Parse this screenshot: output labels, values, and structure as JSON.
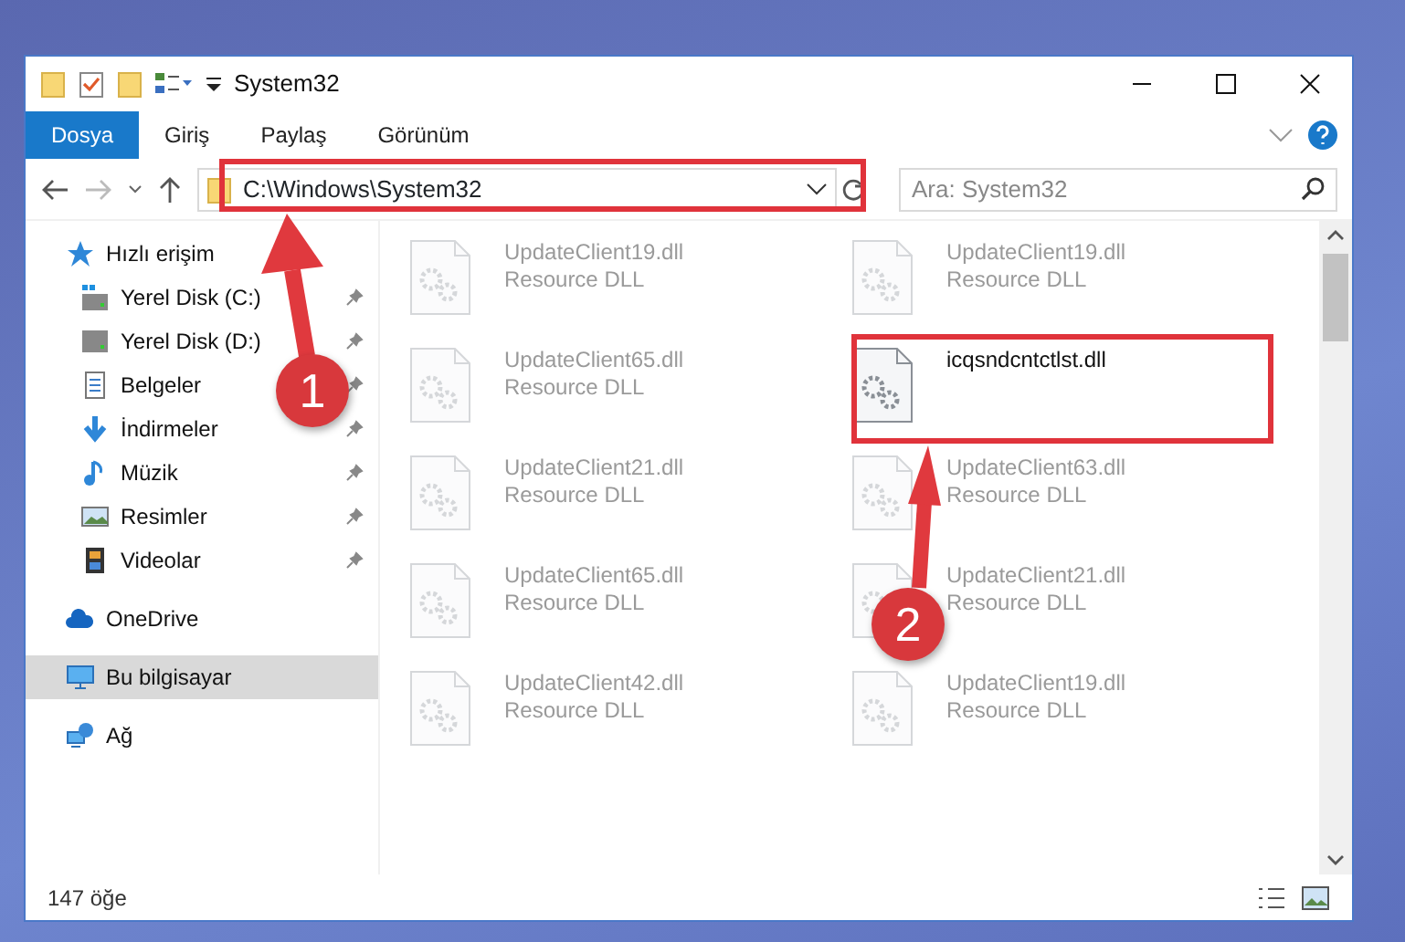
{
  "window": {
    "title": "System32"
  },
  "ribbon_tabs": [
    {
      "label": "Dosya",
      "selected": true
    },
    {
      "label": "Giriş",
      "selected": false
    },
    {
      "label": "Paylaş",
      "selected": false
    },
    {
      "label": "Görünüm",
      "selected": false
    }
  ],
  "address_bar": {
    "path": "C:\\Windows\\System32"
  },
  "search": {
    "placeholder": "Ara: System32"
  },
  "sidebar": {
    "items": [
      {
        "label": "Hızlı erişim",
        "kind": "star",
        "selected": false,
        "children": [
          {
            "label": "Yerel Disk (C:)",
            "kind": "drive-win",
            "pinned": true,
            "selected": false
          },
          {
            "label": "Yerel Disk (D:)",
            "kind": "drive",
            "pinned": true,
            "selected": false
          },
          {
            "label": "Belgeler",
            "kind": "docs",
            "pinned": true,
            "selected": false
          },
          {
            "label": "İndirmeler",
            "kind": "download",
            "pinned": true,
            "selected": false
          },
          {
            "label": "Müzik",
            "kind": "music",
            "pinned": true,
            "selected": false
          },
          {
            "label": "Resimler",
            "kind": "pictures",
            "pinned": true,
            "selected": false
          },
          {
            "label": "Videolar",
            "kind": "videos",
            "pinned": true,
            "selected": false
          }
        ]
      },
      {
        "label": "OneDrive",
        "kind": "cloud",
        "selected": false
      },
      {
        "label": "Bu bilgisayar",
        "kind": "pc",
        "selected": true
      },
      {
        "label": "Ağ",
        "kind": "network",
        "selected": false
      }
    ]
  },
  "files": [
    {
      "name": "UpdateClient19.dll",
      "type": "Resource DLL",
      "blurred": true
    },
    {
      "name": "UpdateClient19.dll",
      "type": "Resource DLL",
      "blurred": true
    },
    {
      "name": "UpdateClient65.dll",
      "type": "Resource DLL",
      "blurred": true
    },
    {
      "name": "icqsndcntctlst.dll",
      "blurred": false
    },
    {
      "name": "UpdateClient21.dll",
      "type": "Resource DLL",
      "blurred": true
    },
    {
      "name": "UpdateClient63.dll",
      "type": "Resource DLL",
      "blurred": true
    },
    {
      "name": "UpdateClient65.dll",
      "type": "Resource DLL",
      "blurred": true
    },
    {
      "name": "UpdateClient21.dll",
      "type": "Resource DLL",
      "blurred": true
    },
    {
      "name": "UpdateClient42.dll",
      "type": "Resource DLL",
      "blurred": true
    },
    {
      "name": "UpdateClient19.dll",
      "type": "Resource DLL",
      "blurred": true
    }
  ],
  "status_bar": {
    "count": "147 öğe"
  },
  "annotations": [
    {
      "label": "1"
    },
    {
      "label": "2"
    }
  ]
}
